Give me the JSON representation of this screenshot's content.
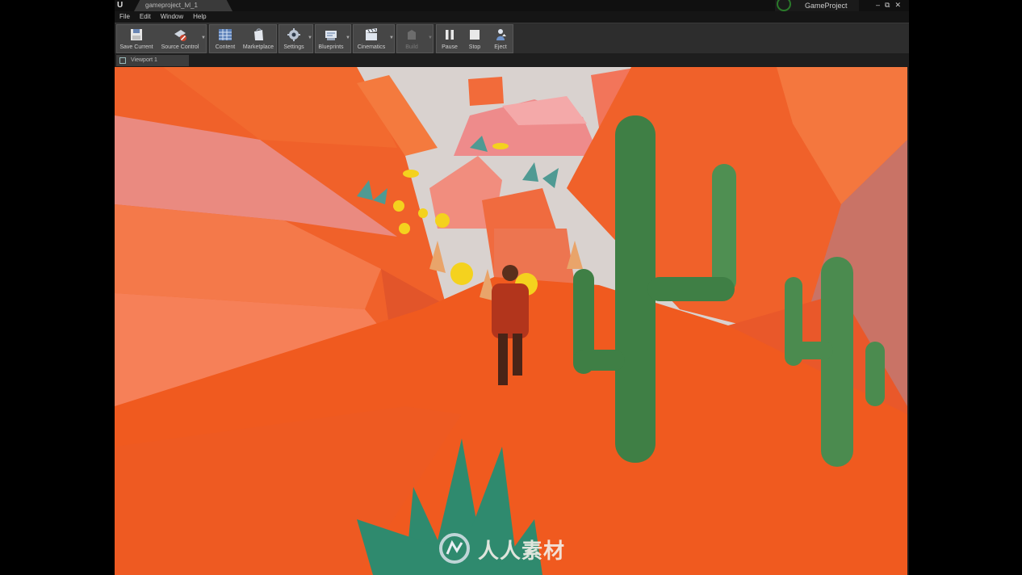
{
  "titlebar": {
    "app_logo": "U",
    "document_tab": "gameproject_lvl_1",
    "project_name": "GameProject",
    "window_controls": [
      "–",
      "⧉",
      "✕"
    ]
  },
  "menu": [
    "File",
    "Edit",
    "Window",
    "Help"
  ],
  "toolbar": {
    "save_current": "Save Current",
    "source_control": "Source Control",
    "content": "Content",
    "marketplace": "Marketplace",
    "settings": "Settings",
    "blueprints": "Blueprints",
    "cinematics": "Cinematics",
    "build": "Build",
    "pause": "Pause",
    "stop": "Stop",
    "eject": "Eject"
  },
  "viewport": {
    "tab_label": "Viewport 1"
  },
  "watermark": {
    "text": "人人素材"
  },
  "colors": {
    "rock": "#f0612a",
    "rock_light": "#f98552",
    "rock_shadow": "#d44a1c",
    "sky": "#d9d2cf",
    "cactus": "#3f7f45",
    "coin": "#f4d21e",
    "ui_dark": "#1b1b1b"
  }
}
